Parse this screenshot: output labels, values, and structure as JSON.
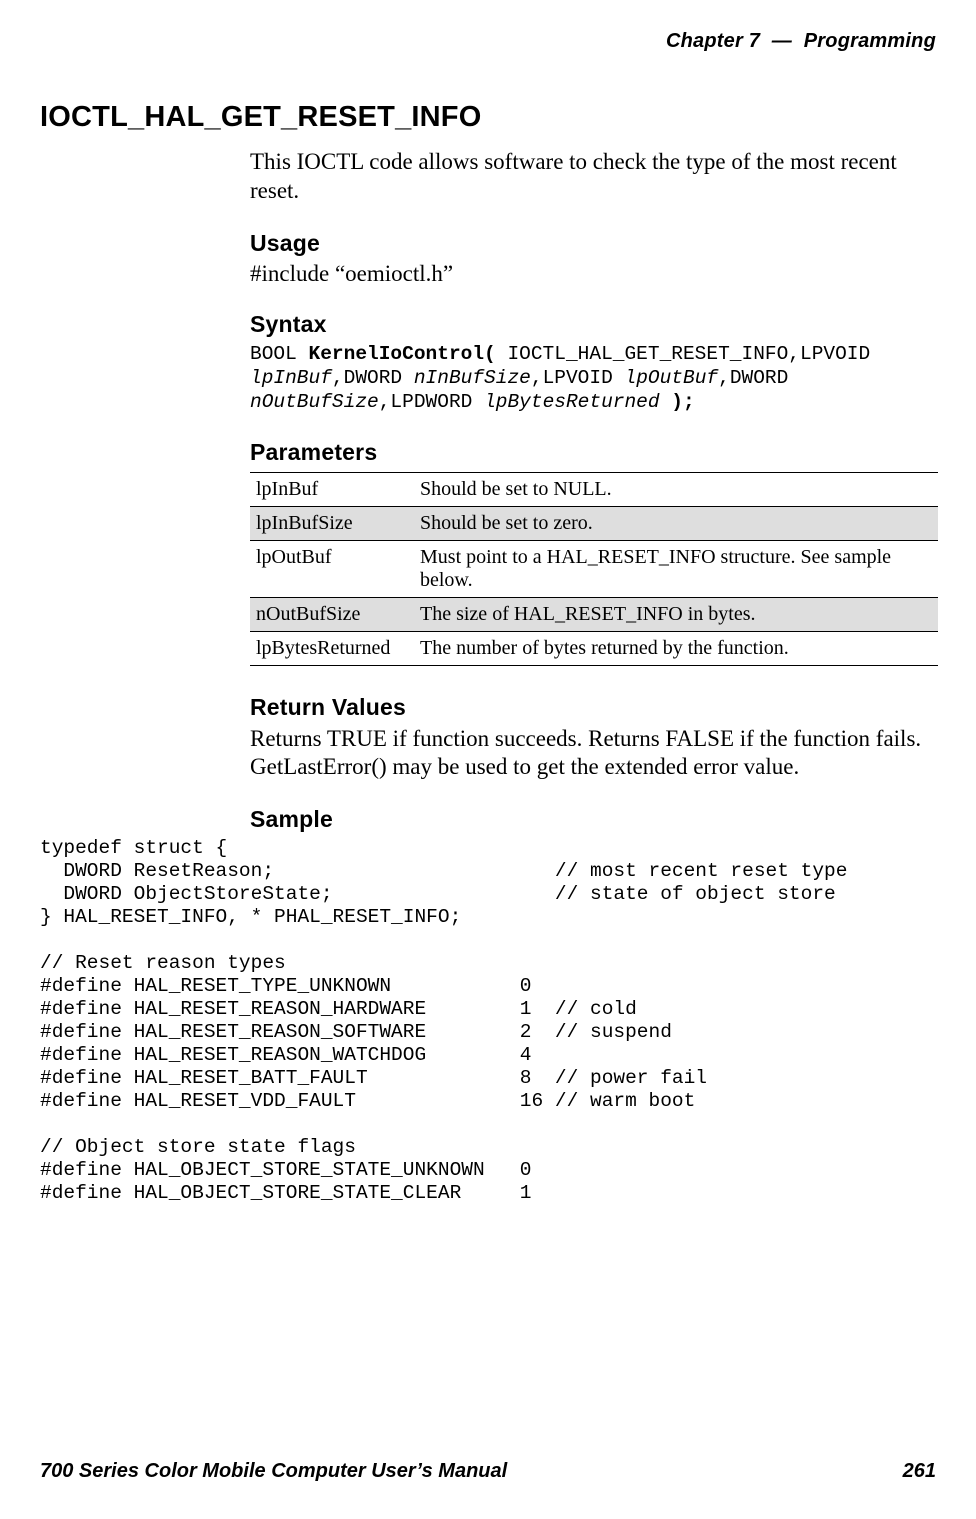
{
  "header": {
    "chapter_label": "Chapter",
    "chapter_num": "7",
    "separator": "—",
    "topic": "Programming"
  },
  "title": "IOCTL_HAL_GET_RESET_INFO",
  "intro": "This IOCTL code allows software to check the type of the most recent reset.",
  "usage": {
    "heading": "Usage",
    "line": "#include “oemioctl.h”"
  },
  "syntax": {
    "heading": "Syntax",
    "ret": "BOOL ",
    "fn": "KernelIoControl( ",
    "p1a": "IOCTL_HAL_GET_RESET_INFO,LPVOID",
    "p1b": "lpInBuf",
    "p2a": ",DWORD ",
    "p2b": "nInBufSize",
    "p3a": ",LPVOID ",
    "p3b": "lpOutBuf",
    "p4a": ",DWORD",
    "p4b": "nOutBufSize",
    "p5a": ",LPDWORD ",
    "p5b": "lpBytesReturned",
    "end": " );"
  },
  "parameters": {
    "heading": "Parameters",
    "rows": [
      {
        "name": "lpInBuf",
        "desc": "Should be set to NULL."
      },
      {
        "name": "lpInBufSize",
        "desc": "Should be set to zero."
      },
      {
        "name": "lpOutBuf",
        "desc": "Must point to a HAL_RESET_INFO structure. See sample below."
      },
      {
        "name": "nOutBufSize",
        "desc": "The size of HAL_RESET_INFO in bytes."
      },
      {
        "name": "lpBytesReturned",
        "desc": "The number of bytes returned by the function."
      }
    ]
  },
  "return_values": {
    "heading": "Return Values",
    "text": "Returns TRUE if function succeeds. Returns FALSE if the function fails. GetLastError() may be used to get the extended error value."
  },
  "sample": {
    "heading": "Sample",
    "code": "typedef struct {\n  DWORD ResetReason;                        // most recent reset type\n  DWORD ObjectStoreState;                   // state of object store\n} HAL_RESET_INFO, * PHAL_RESET_INFO;\n\n// Reset reason types\n#define HAL_RESET_TYPE_UNKNOWN           0\n#define HAL_RESET_REASON_HARDWARE        1  // cold\n#define HAL_RESET_REASON_SOFTWARE        2  // suspend\n#define HAL_RESET_REASON_WATCHDOG        4\n#define HAL_RESET_BATT_FAULT             8  // power fail\n#define HAL_RESET_VDD_FAULT              16 // warm boot\n\n// Object store state flags\n#define HAL_OBJECT_STORE_STATE_UNKNOWN   0\n#define HAL_OBJECT_STORE_STATE_CLEAR     1"
  },
  "footer": {
    "manual": "700 Series Color Mobile Computer User’s Manual",
    "page": "261"
  }
}
